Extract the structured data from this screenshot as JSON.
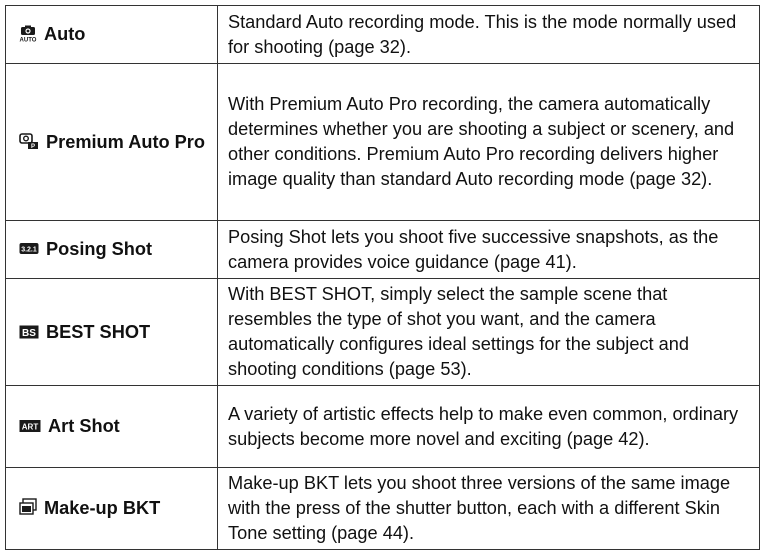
{
  "modes": [
    {
      "icon": "auto-mode-icon",
      "name": "Auto",
      "description": "Standard Auto recording mode. This is the mode normally used for shooting (page 32)."
    },
    {
      "icon": "premium-auto-pro-icon",
      "name": "Premium Auto Pro",
      "description": "With Premium Auto Pro recording, the camera automatically determines whether you are shooting a subject or scenery, and other conditions. Premium Auto Pro recording delivers higher image quality than standard Auto recording mode (page 32)."
    },
    {
      "icon": "posing-shot-icon",
      "name": "Posing Shot",
      "description": "Posing Shot lets you shoot five successive snapshots, as the camera provides voice guidance (page 41)."
    },
    {
      "icon": "best-shot-icon",
      "name": "BEST SHOT",
      "description": "With BEST SHOT, simply select the sample scene that resembles the type of shot you want, and the camera automatically configures ideal settings for the subject and shooting conditions (page 53)."
    },
    {
      "icon": "art-shot-icon",
      "name": "Art Shot",
      "description": "A variety of artistic effects help to make even common, ordinary subjects become more novel and exciting (page 42)."
    },
    {
      "icon": "make-up-bkt-icon",
      "name": "Make-up BKT",
      "description": "Make-up BKT lets you shoot three versions of the same image with the press of the shutter button, each with a different Skin Tone setting (page 44)."
    }
  ],
  "colors": {
    "border": "#333333",
    "text": "#111111",
    "icon": "#1a1a1a"
  }
}
